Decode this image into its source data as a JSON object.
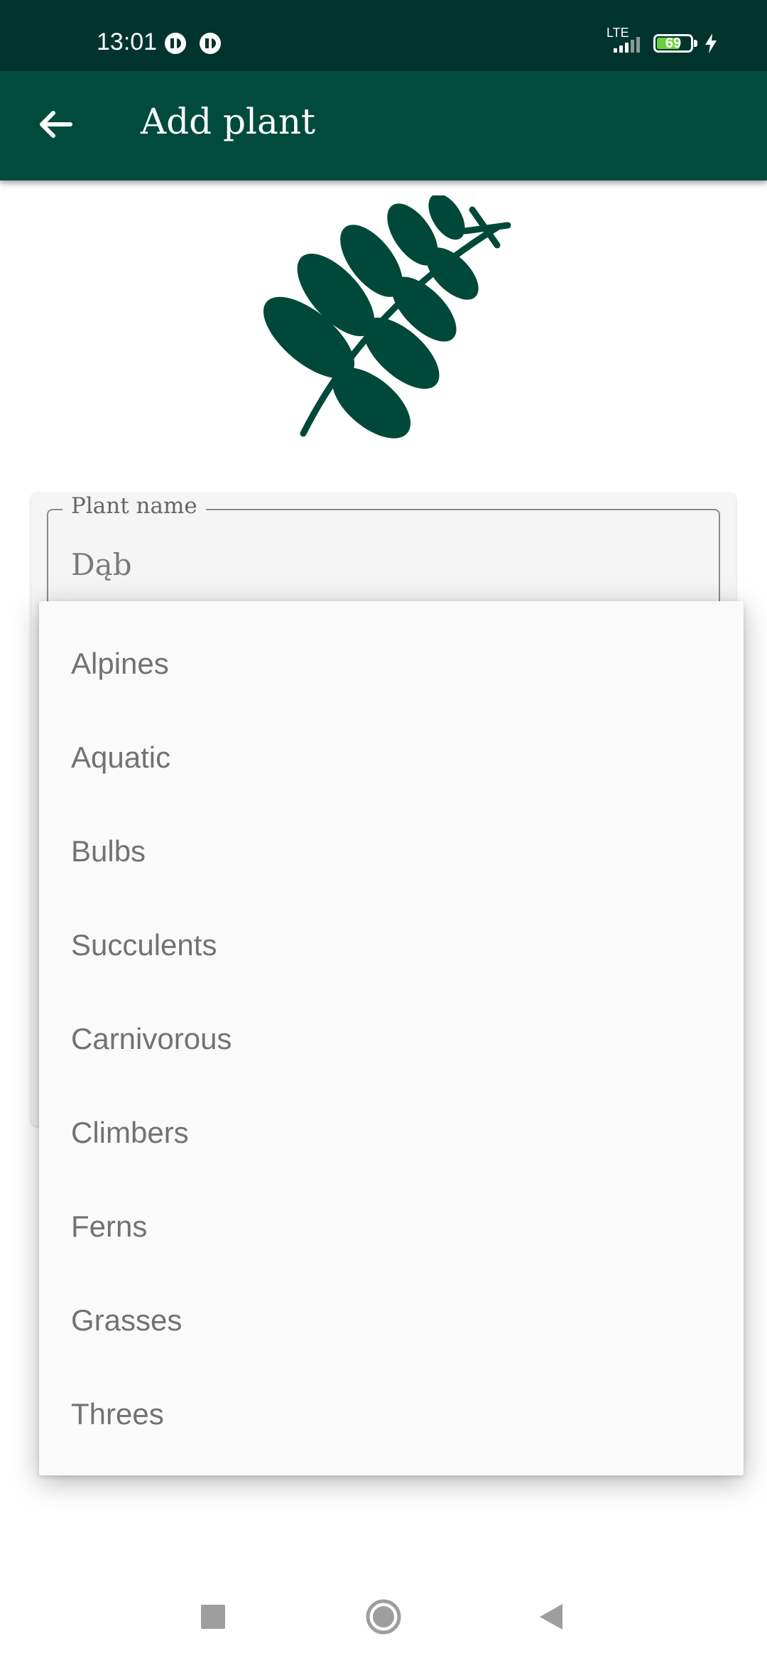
{
  "status_bar": {
    "time": "13:01",
    "network": "LTE",
    "battery_level": "69",
    "battery_fraction": 0.69,
    "icons": [
      "app-notification-icon",
      "app-notification-icon",
      "signal-icon",
      "battery-icon",
      "charging-icon"
    ]
  },
  "app_bar": {
    "title": "Add plant",
    "back_icon": "arrow-back-icon"
  },
  "colors": {
    "primary_dark": "#00342c",
    "primary": "#004b3c",
    "leaf": "#00493a",
    "menu_background": "#fafafa",
    "menu_text": "#727272"
  },
  "form": {
    "plant_name": {
      "label": "Plant name",
      "value": "Dąb"
    }
  },
  "dropdown": {
    "options": [
      "Alpines",
      "Aquatic",
      "Bulbs",
      "Succulents",
      "Carnivorous",
      "Climbers",
      "Ferns",
      "Grasses",
      "Threes"
    ]
  },
  "navigation": {
    "icons": [
      "recents-icon",
      "home-icon",
      "back-triangle-icon"
    ]
  }
}
